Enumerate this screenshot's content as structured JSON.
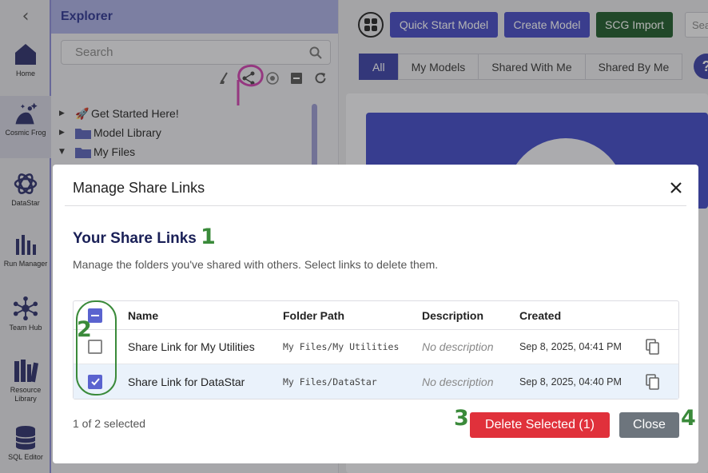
{
  "rail": {
    "collapse_icon": "chevron-left-icon",
    "items": [
      {
        "label": "Home",
        "icon": "home-icon"
      },
      {
        "label": "Cosmic Frog",
        "icon": "cosmic-frog-icon"
      },
      {
        "label": "DataStar",
        "icon": "datastar-icon"
      },
      {
        "label": "Run Manager",
        "icon": "run-manager-icon"
      },
      {
        "label": "Team Hub",
        "icon": "team-hub-icon"
      },
      {
        "label": "Resource Library",
        "icon": "resource-library-icon"
      },
      {
        "label": "SQL Editor",
        "icon": "sql-editor-icon"
      }
    ]
  },
  "explorer": {
    "title": "Explorer",
    "search_placeholder": "Search",
    "tree": [
      {
        "label": "Get Started Here!",
        "expanded": false
      },
      {
        "label": "Model Library",
        "expanded": false
      },
      {
        "label": "My Files",
        "expanded": true
      }
    ]
  },
  "topbar": {
    "buttons": [
      "Quick Start Model",
      "Create Model",
      "SCG Import"
    ],
    "search_placeholder": "Search",
    "tabs": [
      "All",
      "My Models",
      "Shared With Me",
      "Shared By Me"
    ],
    "active_tab": "All",
    "help_label": "?"
  },
  "modal": {
    "title": "Manage Share Links",
    "heading": "Your Share Links",
    "description": "Manage the folders you've shared with others. Select links to delete them.",
    "columns": {
      "name": "Name",
      "path": "Folder Path",
      "description": "Description",
      "created": "Created"
    },
    "rows": [
      {
        "name": "Share Link for My Utilities",
        "path": "My Files/My Utilities",
        "description": "No description",
        "created": "Sep 8, 2025, 04:41 PM",
        "selected": false
      },
      {
        "name": "Share Link for DataStar",
        "path": "My Files/DataStar",
        "description": "No description",
        "created": "Sep 8, 2025, 04:40 PM",
        "selected": true
      }
    ],
    "selection_status": "1 of 2 selected",
    "delete_label": "Delete Selected (1)",
    "close_label": "Close"
  },
  "annotations": [
    "1",
    "2",
    "3",
    "4"
  ],
  "colors": {
    "primary": "#4449c4",
    "danger": "#e0313b",
    "success_dark": "#1e5a2a",
    "annotation_green": "#3a8a3a",
    "annotation_pink": "#d040b0"
  }
}
